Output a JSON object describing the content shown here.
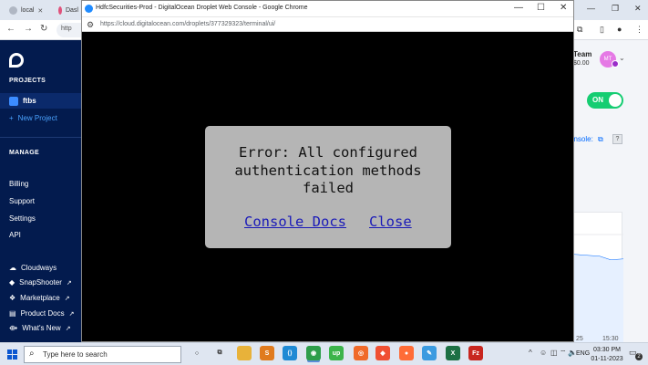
{
  "background_browser": {
    "tabs": [
      {
        "label": "local"
      },
      {
        "label": "Dasl"
      }
    ],
    "address_stub": "http",
    "window_controls": {
      "minimize": "—",
      "restore": "❐",
      "close": "✕"
    },
    "nav": {
      "back": "←",
      "forward": "→",
      "reload": "↻"
    }
  },
  "sidebar": {
    "projects_heading": "PROJECTS",
    "active_project": "ftbs",
    "new_project": "New Project",
    "manage_heading": "MANAGE",
    "manage_items": [
      "Billing",
      "Support",
      "Settings",
      "API"
    ],
    "external_links": [
      {
        "label": "Cloudways",
        "ext": ""
      },
      {
        "label": "SnapShooter",
        "ext": "↗"
      },
      {
        "label": "Marketplace",
        "ext": "↗"
      },
      {
        "label": "Product Docs",
        "ext": "↗"
      },
      {
        "label": "What's New",
        "ext": "↗"
      }
    ]
  },
  "account": {
    "team_label": "Team",
    "balance": "$0.00",
    "avatar_initials": "MT"
  },
  "droplet_panel": {
    "toggle_state": "ON",
    "console_link": "onsole:",
    "help": "?",
    "time_labels": [
      "25",
      "15:30"
    ]
  },
  "popup": {
    "title": "HdfcSecurities-Prod - DigitalOcean Droplet Web Console - Google Chrome",
    "url": "https://cloud.digitalocean.com/droplets/377329323/terminal/ui/",
    "window_controls": {
      "minimize": "—",
      "maximize": "☐",
      "close": "✕"
    },
    "error": {
      "message": "Error: All configured authentication methods failed",
      "docs_link": "Console Docs",
      "close_link": "Close"
    }
  },
  "taskbar": {
    "search_placeholder": "Type here to search",
    "apps": [
      {
        "name": "cortana",
        "glyph": "○",
        "color": "#1b1b1b"
      },
      {
        "name": "task-view",
        "glyph": "⧉",
        "color": "#333333"
      },
      {
        "name": "file-explorer",
        "glyph": "",
        "color": "#e8b23a"
      },
      {
        "name": "sublime-text",
        "glyph": "S",
        "color": "#e07b1e"
      },
      {
        "name": "vscode",
        "glyph": "⟨⟩",
        "color": "#1f8ad4"
      },
      {
        "name": "chrome",
        "glyph": "◉",
        "color": "#2e9e4a"
      },
      {
        "name": "upwork",
        "glyph": "up",
        "color": "#3cb44b"
      },
      {
        "name": "postman",
        "glyph": "◎",
        "color": "#f06a2a"
      },
      {
        "name": "git",
        "glyph": "◆",
        "color": "#f05033"
      },
      {
        "name": "postman-alt",
        "glyph": "●",
        "color": "#ff6c37"
      },
      {
        "name": "paint",
        "glyph": "✎",
        "color": "#3b9be0"
      },
      {
        "name": "excel",
        "glyph": "X",
        "color": "#1d7044"
      },
      {
        "name": "filezilla",
        "glyph": "Fz",
        "color": "#c8261f"
      }
    ],
    "tray": {
      "caret": "^",
      "language": "ENG",
      "time": "03:30 PM",
      "date": "01-11-2023",
      "notifications": "2"
    }
  }
}
